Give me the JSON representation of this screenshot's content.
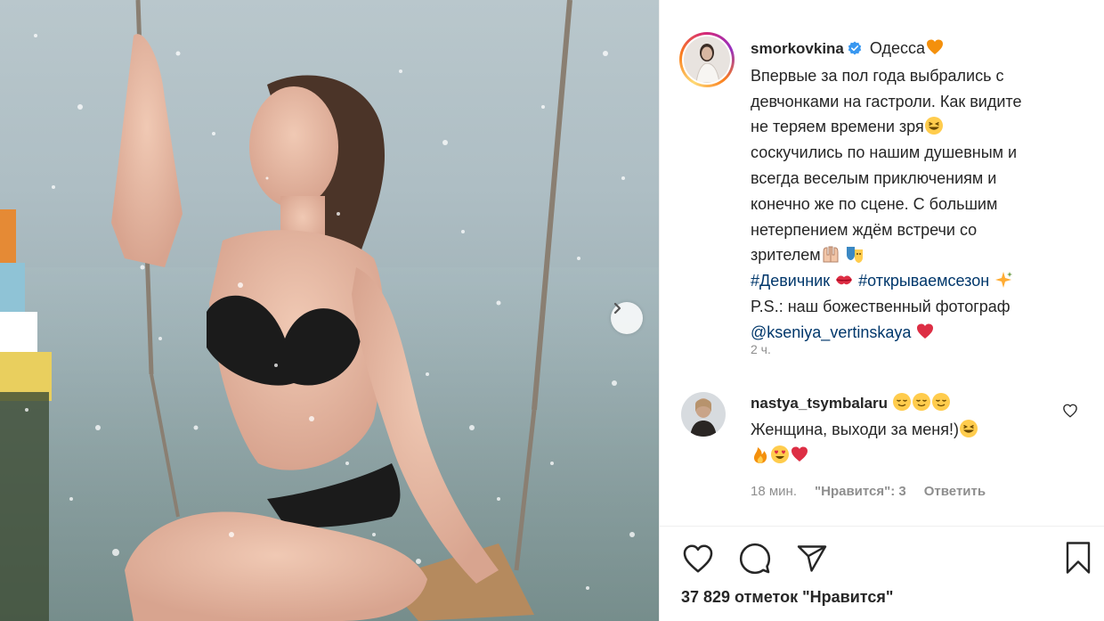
{
  "post": {
    "username": "smorkovkina",
    "location": "Одесса",
    "caption_lines": [
      "Впервые за пол года выбрались с",
      "девчонками на гастроли. Как видите",
      "не теряем времени зря",
      "соскучились по нашим душевным и",
      "всегда веселым приключениям и",
      "конечно же по сцене. С большим",
      "нетерпением ждём встречи со",
      "зрителем"
    ],
    "hashtag_1": "#Девичник",
    "hashtag_2": "#открываемсезон",
    "ps_text": "P.S.: наш божественный фотограф",
    "mention": "@kseniya_vertinskaya",
    "time_ago": "2 ч."
  },
  "comment": {
    "username": "nastya_tsymbalaru",
    "text": "Женщина, выходи за меня!)",
    "time": "18 мин.",
    "likes": "\"Нравится\": 3",
    "reply": "Ответить"
  },
  "actions": {
    "like_icon": "heart-outline-icon",
    "comment_icon": "speech-bubble-icon",
    "share_icon": "paper-plane-icon",
    "save_icon": "bookmark-icon"
  },
  "likes_text": "37 829 отметок \"Нравится\"",
  "colors": {
    "link": "#00376b",
    "verified": "#3897f0",
    "muted": "#8e8e8e",
    "text": "#262626"
  }
}
